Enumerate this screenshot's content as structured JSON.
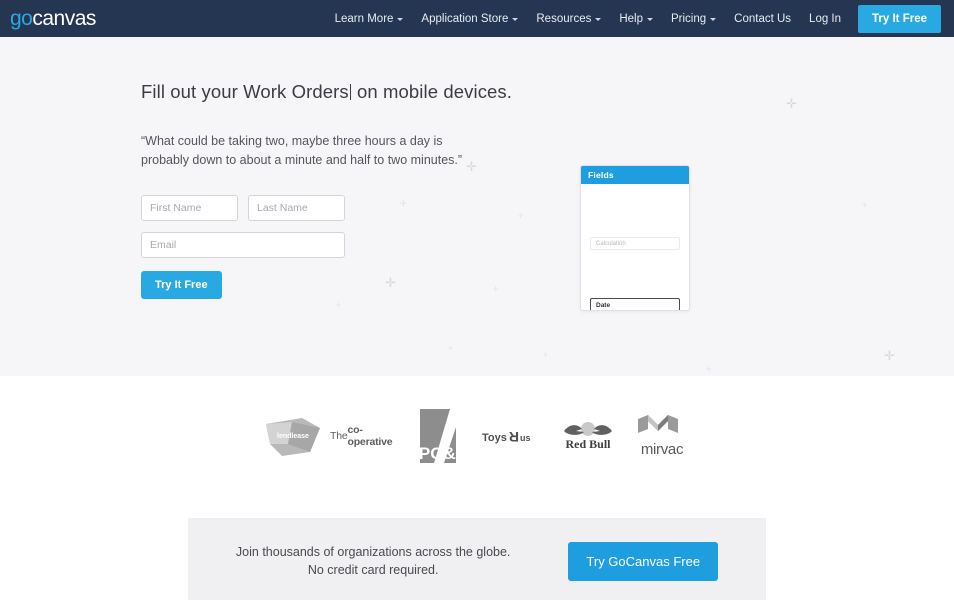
{
  "nav": {
    "logo": {
      "part1": "go",
      "part2": "canvas",
      "accent": "#29a9e1"
    },
    "items": [
      {
        "label": "Learn More",
        "has_chevron": true
      },
      {
        "label": "Application Store",
        "has_chevron": true
      },
      {
        "label": "Resources",
        "has_chevron": true
      },
      {
        "label": "Help",
        "has_chevron": true
      },
      {
        "label": "Pricing",
        "has_chevron": true
      },
      {
        "label": "Contact Us",
        "has_chevron": false
      },
      {
        "label": "Log In",
        "has_chevron": false
      }
    ],
    "cta_label": "Try It Free",
    "background": "#243651"
  },
  "hero": {
    "title_before": "Fill out your Work Orders",
    "title_after": " on mobile devices.",
    "quote": "“What could be taking two, maybe three hours a day is probably down to about a minute and half to two minutes.”",
    "background": "#f6f5f8",
    "form": {
      "first_name_placeholder": "First Name",
      "first_name_value": "",
      "last_name_placeholder": "Last Name",
      "last_name_value": "",
      "email_placeholder": "Email",
      "email_value": "",
      "submit_label": "Try It Free"
    },
    "mockup": {
      "header": "Fields",
      "header_color": "#1e9ede",
      "calculation_label": "Calculation",
      "date_label": "Date"
    }
  },
  "logos": {
    "items": [
      {
        "name": "lendlease",
        "text": "lendlease"
      },
      {
        "name": "the-co-operative",
        "text_thin": "The ",
        "text_bold": "co-operative"
      },
      {
        "name": "pge",
        "text": "PG&E"
      },
      {
        "name": "toys-r-us",
        "text": "ToysRus"
      },
      {
        "name": "red-bull",
        "text": "Red Bull"
      },
      {
        "name": "mirvac",
        "text": "mirvac"
      }
    ]
  },
  "cta": {
    "line1": "Join thousands of organizations across the globe.",
    "line2": "No credit card required.",
    "button_label": "Try GoCanvas Free",
    "button_color": "#1e9ede",
    "box_background": "#f0f0f2"
  }
}
